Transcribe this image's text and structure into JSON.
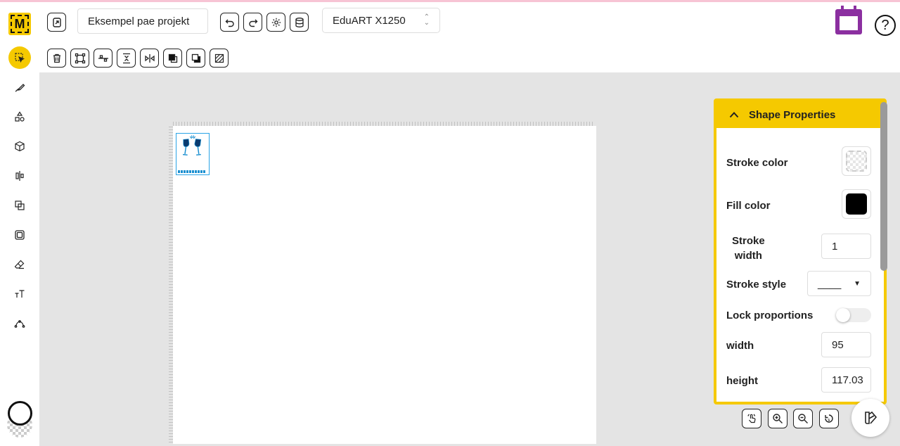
{
  "app": {
    "logo_letter": "M",
    "project_name": "Eksempel pae projekt",
    "machine": "EduART X1250"
  },
  "colors": {
    "accent": "#f5c900",
    "calendar": "#8b2fa0",
    "selection": "#2aa3e6",
    "fill_color": "#000000"
  },
  "toolbar_top": [
    "new-file-icon",
    "undo-icon",
    "redo-icon",
    "settings-gear-icon",
    "database-icon"
  ],
  "toolbar_shape": [
    "trash-icon",
    "bounding-box-icon",
    "align-horizontal-icon",
    "align-vertical-icon",
    "flip-icon",
    "bring-front-icon",
    "send-back-icon",
    "hatch-fill-icon"
  ],
  "sidebar_tools": [
    "select-tool-icon",
    "draw-tool-icon",
    "shapes-tool-icon",
    "cube-tool-icon",
    "align-tool-icon",
    "combine-tool-icon",
    "frame-tool-icon",
    "eraser-tool-icon",
    "text-tool-icon",
    "path-tool-icon"
  ],
  "panel": {
    "title": "Shape Properties",
    "stroke_color_label": "Stroke color",
    "fill_color_label": "Fill color",
    "stroke_width_label_1": "Stroke",
    "stroke_width_label_2": "width",
    "stroke_width_value": "1",
    "stroke_style_label": "Stroke style",
    "stroke_style_value": "____",
    "lock_proportions_label": "Lock proportions",
    "lock_proportions_on": false,
    "width_label": "width",
    "width_value": "95",
    "height_label": "height",
    "height_value": "117.03"
  },
  "zoom_controls": [
    "touch-icon",
    "zoom-in-icon",
    "zoom-out-icon",
    "reset-view-icon"
  ]
}
